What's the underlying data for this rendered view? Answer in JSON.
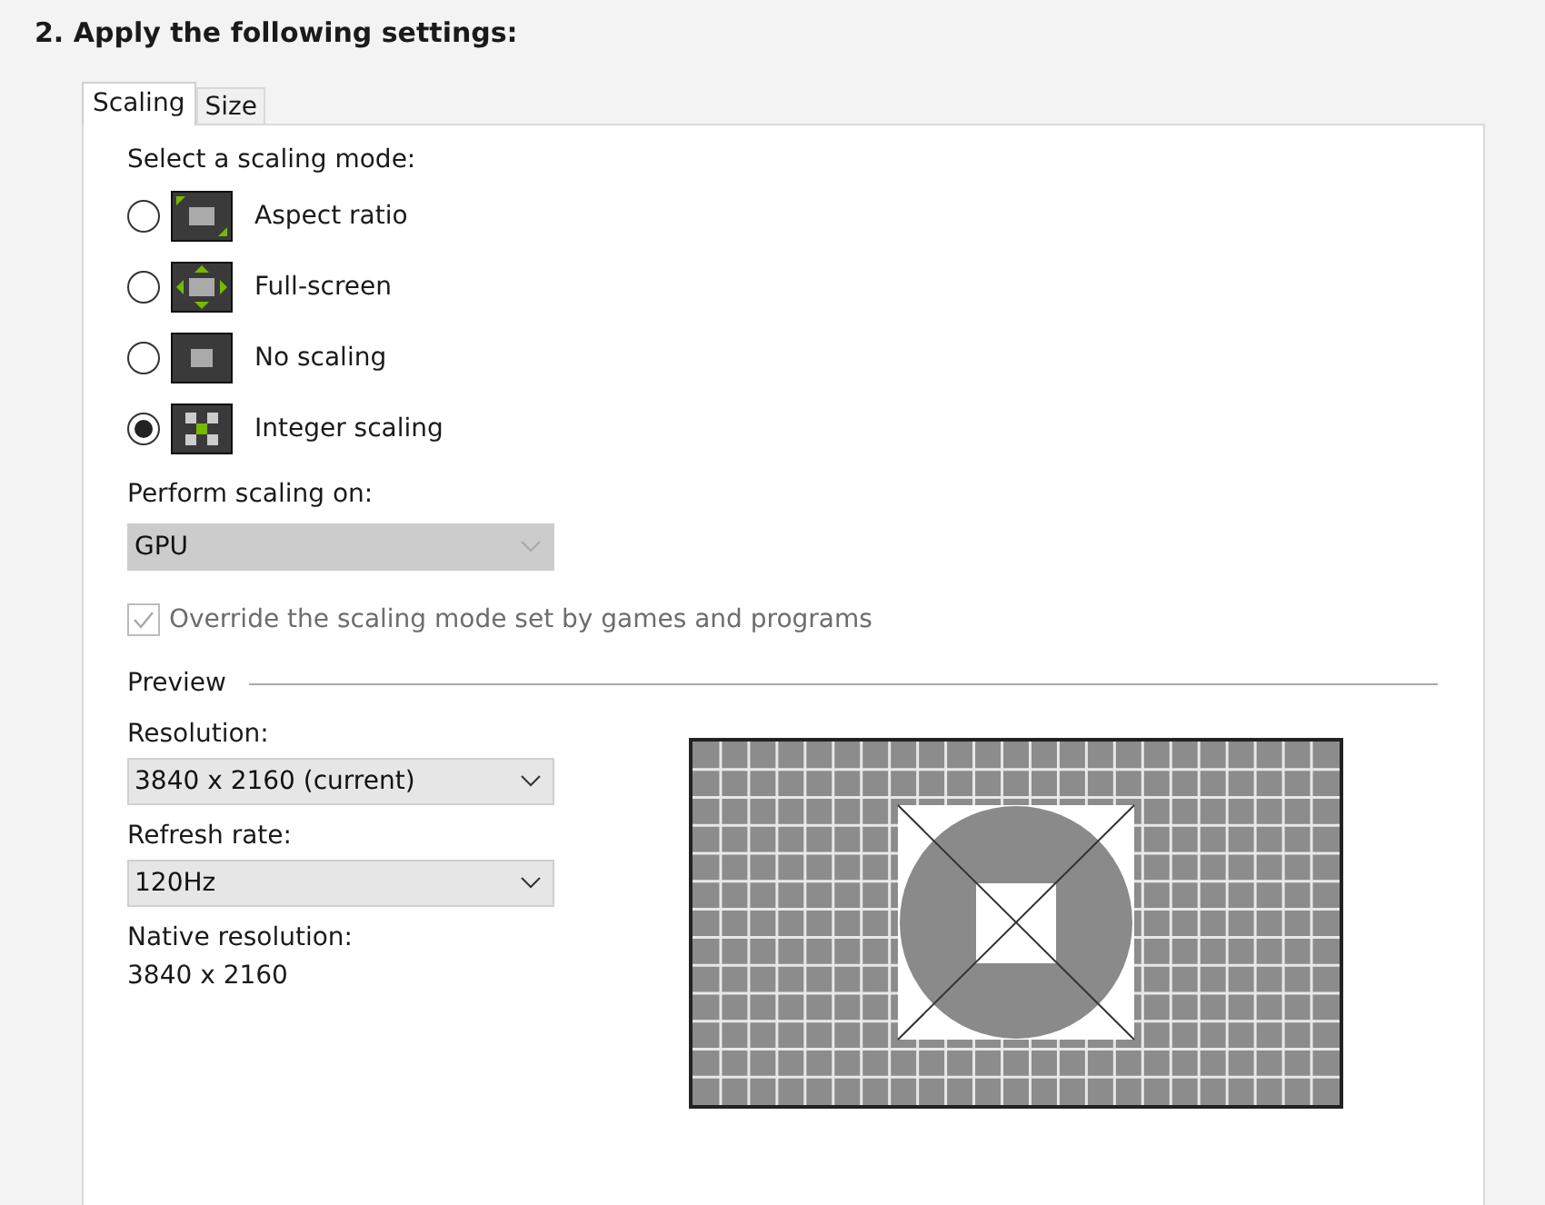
{
  "heading": "2. Apply the following settings:",
  "tabs": [
    {
      "label": "Scaling",
      "selected": true
    },
    {
      "label": "Size",
      "selected": false
    }
  ],
  "scaling_mode": {
    "label": "Select a scaling mode:",
    "options": [
      {
        "label": "Aspect ratio",
        "selected": false
      },
      {
        "label": "Full-screen",
        "selected": false
      },
      {
        "label": "No scaling",
        "selected": false
      },
      {
        "label": "Integer scaling",
        "selected": true
      }
    ]
  },
  "perform_scaling": {
    "label": "Perform scaling on:",
    "value": "GPU",
    "disabled": true
  },
  "override": {
    "label": "Override the scaling mode set by games and programs",
    "checked": true,
    "disabled": true
  },
  "preview": {
    "title": "Preview",
    "resolution": {
      "label": "Resolution:",
      "value": "3840 x 2160 (current)",
      "disabled": false
    },
    "refresh_rate": {
      "label": "Refresh rate:",
      "value": "120Hz",
      "disabled": false
    },
    "native_resolution": {
      "label": "Native resolution:",
      "value": "3840 x 2160"
    }
  }
}
